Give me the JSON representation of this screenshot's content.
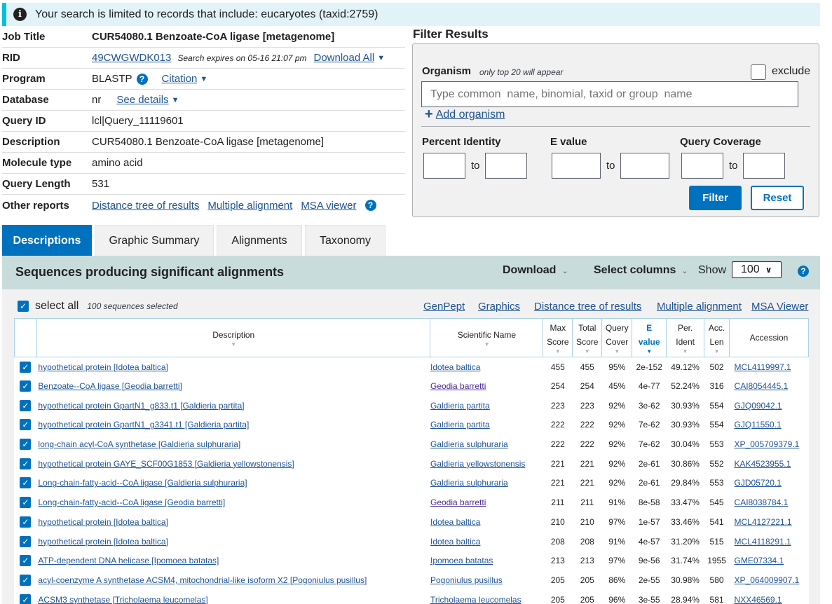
{
  "notice": {
    "icon": "info-icon",
    "text": "Your search is limited to records that include: eucaryotes (taxid:2759)"
  },
  "job": {
    "job_title_label": "Job Title",
    "job_title": "CUR54080.1 Benzoate-CoA ligase [metagenome]",
    "rid_label": "RID",
    "rid": "49CWGWDK013",
    "expires": "Search expires on 05-16 21:07 pm",
    "download_all": "Download All",
    "program_label": "Program",
    "program": "BLASTP",
    "citation": "Citation",
    "database_label": "Database",
    "database": "nr",
    "see_details": "See details",
    "query_id_label": "Query ID",
    "query_id": "lcl|Query_11119601",
    "description_label": "Description",
    "description": "CUR54080.1 Benzoate-CoA ligase [metagenome]",
    "molecule_label": "Molecule type",
    "molecule": "amino acid",
    "length_label": "Query Length",
    "length": "531",
    "other_label": "Other reports",
    "other_links": [
      "Distance tree of results",
      "Multiple alignment",
      "MSA viewer"
    ]
  },
  "filter": {
    "title": "Filter Results",
    "organism_label": "Organism",
    "organism_note": "only top 20 will appear",
    "exclude_label": "exclude",
    "organism_placeholder": "Type common  name, binomial, taxid or group  name",
    "add_organism": "Add organism",
    "percent_identity": "Percent Identity",
    "evalue": "E value",
    "query_coverage": "Query Coverage",
    "to": "to",
    "filter_btn": "Filter",
    "reset_btn": "Reset"
  },
  "tabs": [
    "Descriptions",
    "Graphic Summary",
    "Alignments",
    "Taxonomy"
  ],
  "results_bar": {
    "title": "Sequences producing significant alignments",
    "download": "Download",
    "select_columns": "Select columns",
    "show": "Show",
    "show_value": "100"
  },
  "results": {
    "select_all": "select all",
    "selected_count": "100 sequences selected",
    "links": [
      "GenPept",
      "Graphics",
      "Distance tree of results",
      "Multiple alignment",
      "MSA Viewer"
    ]
  },
  "table": {
    "headers": {
      "description": "Description",
      "scientific_name": "Scientific Name",
      "max_score": [
        "Max",
        "Score"
      ],
      "total_score": [
        "Total",
        "Score"
      ],
      "query_cover": [
        "Query",
        "Cover"
      ],
      "evalue": [
        "E",
        "value"
      ],
      "per_ident": [
        "Per.",
        "Ident"
      ],
      "acc_len": [
        "Acc.",
        "Len"
      ],
      "accession": "Accession"
    },
    "rows": [
      {
        "desc": "hypothetical protein [Idotea baltica]",
        "sci": "Idotea baltica",
        "max": "455",
        "total": "455",
        "cover": "95%",
        "e": "2e-152",
        "ident": "49.12%",
        "len": "502",
        "acc": "MCL4119997.1"
      },
      {
        "desc": "Benzoate--CoA ligase [Geodia barretti]",
        "sci": "Geodia barretti",
        "max": "254",
        "total": "254",
        "cover": "45%",
        "e": "4e-77",
        "ident": "52.24%",
        "len": "316",
        "acc": "CAI8054445.1"
      },
      {
        "desc": "hypothetical protein GpartN1_g833.t1 [Galdieria partita]",
        "sci": "Galdieria partita",
        "max": "223",
        "total": "223",
        "cover": "92%",
        "e": "3e-62",
        "ident": "30.93%",
        "len": "554",
        "acc": "GJQ09042.1"
      },
      {
        "desc": "hypothetical protein GpartN1_g3341.t1 [Galdieria partita]",
        "sci": "Galdieria partita",
        "max": "222",
        "total": "222",
        "cover": "92%",
        "e": "7e-62",
        "ident": "30.93%",
        "len": "554",
        "acc": "GJQ11550.1"
      },
      {
        "desc": "long-chain acyl-CoA synthetase [Galdieria sulphuraria]",
        "sci": "Galdieria sulphuraria",
        "max": "222",
        "total": "222",
        "cover": "92%",
        "e": "7e-62",
        "ident": "30.04%",
        "len": "553",
        "acc": "XP_005709379.1"
      },
      {
        "desc": "hypothetical protein GAYE_SCF00G1853 [Galdieria yellowstonensis]",
        "sci": "Galdieria yellowstonensis",
        "max": "221",
        "total": "221",
        "cover": "92%",
        "e": "2e-61",
        "ident": "30.86%",
        "len": "552",
        "acc": "KAK4523955.1"
      },
      {
        "desc": "Long-chain-fatty-acid--CoA ligase [Galdieria sulphuraria]",
        "sci": "Galdieria sulphuraria",
        "max": "221",
        "total": "221",
        "cover": "92%",
        "e": "2e-61",
        "ident": "29.84%",
        "len": "553",
        "acc": "GJD05720.1"
      },
      {
        "desc": "Long-chain-fatty-acid--CoA ligase [Geodia barretti]",
        "sci": "Geodia barretti",
        "max": "211",
        "total": "211",
        "cover": "91%",
        "e": "8e-58",
        "ident": "33.47%",
        "len": "545",
        "acc": "CAI8038784.1"
      },
      {
        "desc": "hypothetical protein [Idotea baltica]",
        "sci": "Idotea baltica",
        "max": "210",
        "total": "210",
        "cover": "97%",
        "e": "1e-57",
        "ident": "33.46%",
        "len": "541",
        "acc": "MCL4127221.1"
      },
      {
        "desc": "hypothetical protein [Idotea baltica]",
        "sci": "Idotea baltica",
        "max": "208",
        "total": "208",
        "cover": "91%",
        "e": "4e-57",
        "ident": "31.20%",
        "len": "515",
        "acc": "MCL4118291.1"
      },
      {
        "desc": "ATP-dependent DNA helicase [Ipomoea batatas]",
        "sci": "Ipomoea batatas",
        "max": "213",
        "total": "213",
        "cover": "97%",
        "e": "9e-56",
        "ident": "31.74%",
        "len": "1955",
        "acc": "GME07334.1"
      },
      {
        "desc": "acyl-coenzyme A synthetase ACSM4, mitochondrial-like isoform X2 [Pogoniulus pusillus]",
        "sci": "Pogoniulus pusillus",
        "max": "205",
        "total": "205",
        "cover": "86%",
        "e": "2e-55",
        "ident": "30.98%",
        "len": "580",
        "acc": "XP_064009907.1"
      },
      {
        "desc": "ACSM3 synthetase [Tricholaema leucomelas]",
        "sci": "Tricholaema leucomelas",
        "max": "205",
        "total": "205",
        "cover": "96%",
        "e": "3e-55",
        "ident": "28.94%",
        "len": "581",
        "acc": "NXX46569.1"
      }
    ]
  }
}
